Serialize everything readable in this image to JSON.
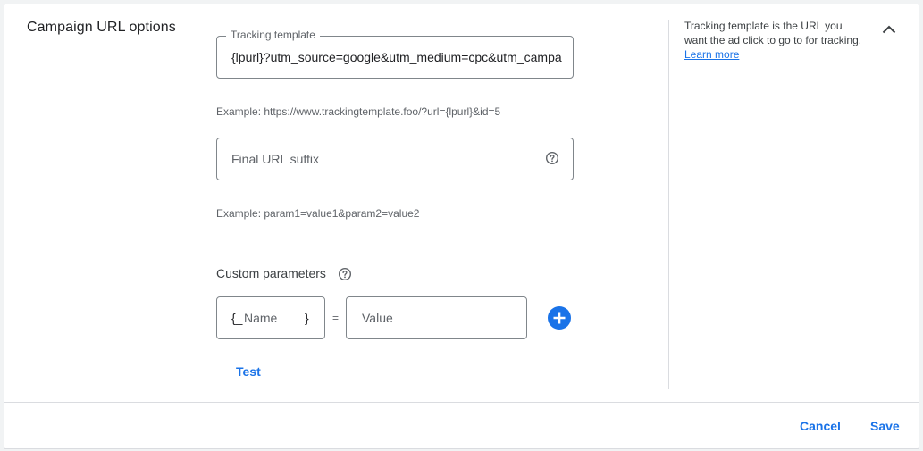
{
  "section": {
    "title": "Campaign URL options"
  },
  "tracking_template": {
    "label": "Tracking template",
    "value": "{lpurl}?utm_source=google&utm_medium=cpc&utm_campaign",
    "example": "Example: https://www.trackingtemplate.foo/?url={lpurl}&id=5"
  },
  "final_url_suffix": {
    "placeholder": "Final URL suffix",
    "example": "Example: param1=value1&param2=value2"
  },
  "custom_parameters": {
    "label": "Custom parameters",
    "name_open": "{_",
    "name_placeholder": "Name",
    "name_close": "}",
    "equals": "=",
    "value_placeholder": "Value"
  },
  "test_label": "Test",
  "info_panel": {
    "text": "Tracking template is the URL you want the ad click to go to for tracking.",
    "link": "Learn more"
  },
  "footer": {
    "cancel_label": "Cancel",
    "save_label": "Save"
  },
  "icons": {
    "help": "help-circle-icon",
    "add": "add-circle-icon",
    "collapse": "chevron-up-icon"
  },
  "colors": {
    "accent": "#1a73e8",
    "border": "#80868b",
    "divider": "#dadce0"
  }
}
